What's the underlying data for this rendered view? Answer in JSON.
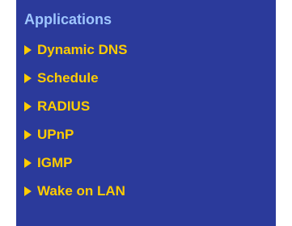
{
  "menu": {
    "heading": "Applications",
    "items": [
      {
        "label": "Dynamic DNS",
        "icon": "arrow-right-icon"
      },
      {
        "label": "Schedule",
        "icon": "arrow-right-icon"
      },
      {
        "label": "RADIUS",
        "icon": "arrow-right-icon"
      },
      {
        "label": "UPnP",
        "icon": "arrow-right-icon"
      },
      {
        "label": "IGMP",
        "icon": "arrow-right-icon"
      },
      {
        "label": "Wake on LAN",
        "icon": "arrow-right-icon"
      }
    ]
  },
  "colors": {
    "panel_background": "#2b3a9b",
    "heading_text": "#9ec6ff",
    "item_text": "#ffcc00",
    "arrow": "#ffcc00"
  }
}
